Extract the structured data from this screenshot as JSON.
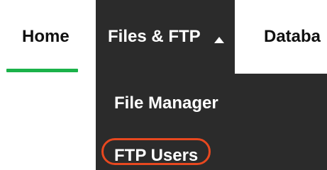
{
  "nav": {
    "tabs": [
      {
        "label": "Home"
      },
      {
        "label": "Files & FTP"
      },
      {
        "label": "Databa"
      }
    ],
    "active_indicator_color": "#1bb24a",
    "open_tab_background": "#2b2b2b"
  },
  "dropdown": {
    "items": [
      {
        "label": "File Manager"
      },
      {
        "label": "FTP Users"
      }
    ],
    "highlight_color": "#e8481f"
  },
  "icons": {
    "caret": "chevron-up-icon"
  }
}
